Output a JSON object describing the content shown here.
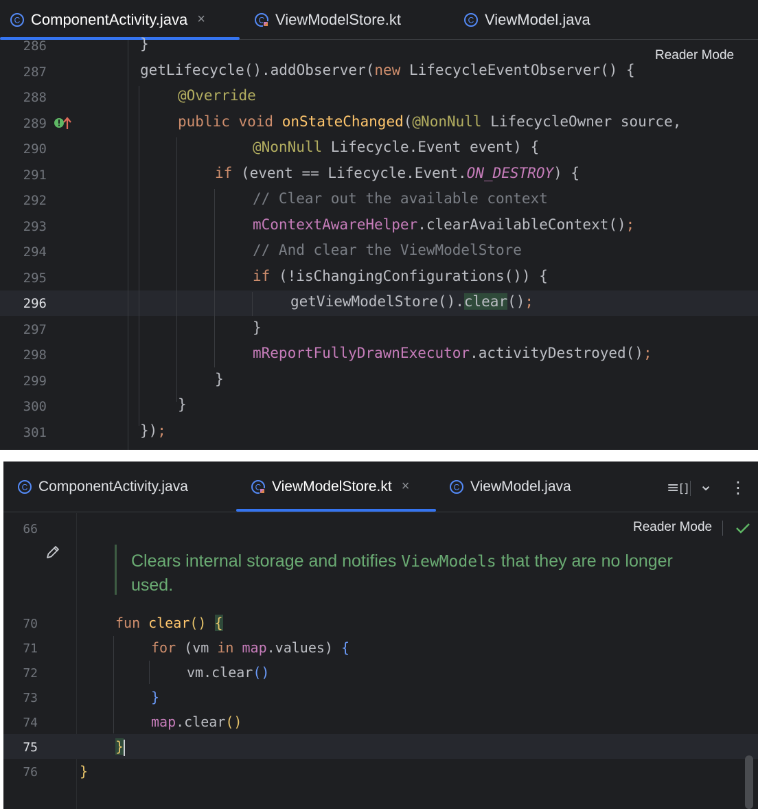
{
  "top_editor": {
    "tabs": [
      {
        "label": "ComponentActivity.java",
        "active": true,
        "close": "×"
      },
      {
        "label": "ViewModelStore.kt",
        "active": false
      },
      {
        "label": "ViewModel.java",
        "active": false
      }
    ],
    "reader_mode": "Reader Mode",
    "lines": [
      "286",
      "287",
      "288",
      "289",
      "290",
      "291",
      "292",
      "293",
      "294",
      "295",
      "296",
      "297",
      "298",
      "299",
      "300",
      "301"
    ],
    "current_line": "296",
    "code": {
      "l286": "}",
      "l287_a": "getLifecycle().addObserver(",
      "l287_b": "new",
      "l287_c": " LifecycleEventObserver() {",
      "l288": "@Override",
      "l289_a": "public void",
      "l289_b": "onStateChanged",
      "l289_c": "(",
      "l289_d": "@NonNull",
      "l289_e": " LifecycleOwner source,",
      "l290_a": "@NonNull",
      "l290_b": " Lifecycle.Event event) {",
      "l291_a": "if",
      "l291_b": " (event == Lifecycle.Event.",
      "l291_c": "ON_DESTROY",
      "l291_d": ") {",
      "l292": "// Clear out the available context",
      "l293_a": "mContextAwareHelper",
      "l293_b": ".clearAvailableContext()",
      "l293_c": ";",
      "l294": "// And clear the ViewModelStore",
      "l295_a": "if",
      "l295_b": " (!isChangingConfigurations()) {",
      "l296_a": "getViewModelStore().",
      "l296_b": "clear",
      "l296_c": "()",
      "l296_d": ";",
      "l297": "}",
      "l298_a": "mReportFullyDrawnExecutor",
      "l298_b": ".activityDestroyed()",
      "l298_c": ";",
      "l299": "}",
      "l300": "}",
      "l301_a": "})",
      "l301_b": ";"
    }
  },
  "bottom_editor": {
    "tabs": [
      {
        "label": "ComponentActivity.java",
        "active": false
      },
      {
        "label": "ViewModelStore.kt",
        "active": true,
        "close": "×"
      },
      {
        "label": "ViewModel.java",
        "active": false
      }
    ],
    "toolbar": {
      "menu_glyph": "≡",
      "bracket_glyph": "[]",
      "chevron": "⌄",
      "more": "⋮"
    },
    "reader_mode": "Reader Mode",
    "lines": [
      "66",
      "70",
      "71",
      "72",
      "73",
      "74",
      "75",
      "76"
    ],
    "current_line": "75",
    "doc_comment": {
      "text_a": "Clears internal storage and notifies ",
      "code": "ViewModels",
      "text_b": " that they are no longer",
      "text_c": "used."
    },
    "code": {
      "l70_a": "fun",
      "l70_b": "clear",
      "l70_c": "()",
      "l70_d": "{",
      "l71_a": "for",
      "l71_b": " (vm ",
      "l71_c": "in",
      "l71_d": "map",
      "l71_e": ".values) ",
      "l71_f": "{",
      "l72_a": "vm.clear",
      "l72_b": "()",
      "l73": "}",
      "l74_a": "map",
      "l74_b": ".clear",
      "l74_c": "()",
      "l75": "}",
      "l76": "}"
    }
  }
}
